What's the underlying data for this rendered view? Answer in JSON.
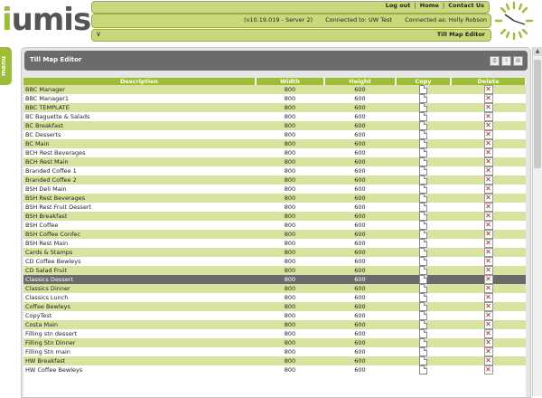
{
  "logo": {
    "i": "i",
    "mis": "umis"
  },
  "nav": {
    "logout": "Log out",
    "home": "Home",
    "contact": "Contact Us",
    "sep": "|"
  },
  "status": {
    "version": "(v10.19.019 - Server 2)",
    "connected_to": "Connected to: UW Test",
    "connected_as": "Connected as: Holly Robson"
  },
  "breadcrumb": {
    "current": "Till Map Editor"
  },
  "menu": {
    "label": "menu"
  },
  "panel": {
    "title": "Till Map Editor"
  },
  "table": {
    "headers": {
      "description": "Description",
      "width": "Width",
      "height": "Height",
      "copy": "Copy",
      "delete": "Delete"
    },
    "rows": [
      {
        "description": "BBC Manager",
        "width": "800",
        "height": "600"
      },
      {
        "description": "BBC Manager1",
        "width": "800",
        "height": "600"
      },
      {
        "description": "BBC TEMPLATE",
        "width": "800",
        "height": "600"
      },
      {
        "description": "BC Baguette & Salads",
        "width": "800",
        "height": "600"
      },
      {
        "description": "BC Breakfast",
        "width": "800",
        "height": "600"
      },
      {
        "description": "BC Desserts",
        "width": "800",
        "height": "600"
      },
      {
        "description": "BC Main",
        "width": "800",
        "height": "600"
      },
      {
        "description": "BCH Rest Beverages",
        "width": "800",
        "height": "600"
      },
      {
        "description": "BCH Rest Main",
        "width": "800",
        "height": "600"
      },
      {
        "description": "Branded Coffee 1",
        "width": "800",
        "height": "600"
      },
      {
        "description": "Branded Coffee 2",
        "width": "800",
        "height": "600"
      },
      {
        "description": "BSH Deli Main",
        "width": "800",
        "height": "600"
      },
      {
        "description": "BSH Rest Beverages",
        "width": "800",
        "height": "600"
      },
      {
        "description": "BSH Rest Fruit Dessert",
        "width": "800",
        "height": "600"
      },
      {
        "description": "BSH Breakfast",
        "width": "800",
        "height": "600"
      },
      {
        "description": "BSH Coffee",
        "width": "800",
        "height": "600"
      },
      {
        "description": "BSH Coffee Confec",
        "width": "800",
        "height": "600"
      },
      {
        "description": "BSH Rest Main",
        "width": "800",
        "height": "600"
      },
      {
        "description": "Cards & Stamps",
        "width": "800",
        "height": "600"
      },
      {
        "description": "CD Coffee Bewleys",
        "width": "800",
        "height": "600"
      },
      {
        "description": "CD Salad Fruit",
        "width": "800",
        "height": "600"
      },
      {
        "description": "Classics Dessert",
        "width": "800",
        "height": "600",
        "selected": true
      },
      {
        "description": "Classics Dinner",
        "width": "800",
        "height": "600"
      },
      {
        "description": "Classics Lunch",
        "width": "800",
        "height": "600"
      },
      {
        "description": "Coffee Bewleys",
        "width": "800",
        "height": "600"
      },
      {
        "description": "CopyTest",
        "width": "800",
        "height": "600"
      },
      {
        "description": "Costa Main",
        "width": "800",
        "height": "600"
      },
      {
        "description": "Filling stn dessert",
        "width": "800",
        "height": "600"
      },
      {
        "description": "Filling Stn Dinner",
        "width": "800",
        "height": "600"
      },
      {
        "description": "Filling Stn main",
        "width": "800",
        "height": "600"
      },
      {
        "description": "HW Breakfast",
        "width": "800",
        "height": "600"
      },
      {
        "description": "HW Coffee Bewleys",
        "width": "800",
        "height": "600"
      }
    ]
  },
  "colors": {
    "accent": "#9ebd37",
    "row_alt": "#d9e39f",
    "selected": "#6b6b6b",
    "delete": "#c0181a"
  },
  "icons": {
    "copy": "copy-icon",
    "delete": "delete-icon",
    "clock": "clock-icon"
  }
}
